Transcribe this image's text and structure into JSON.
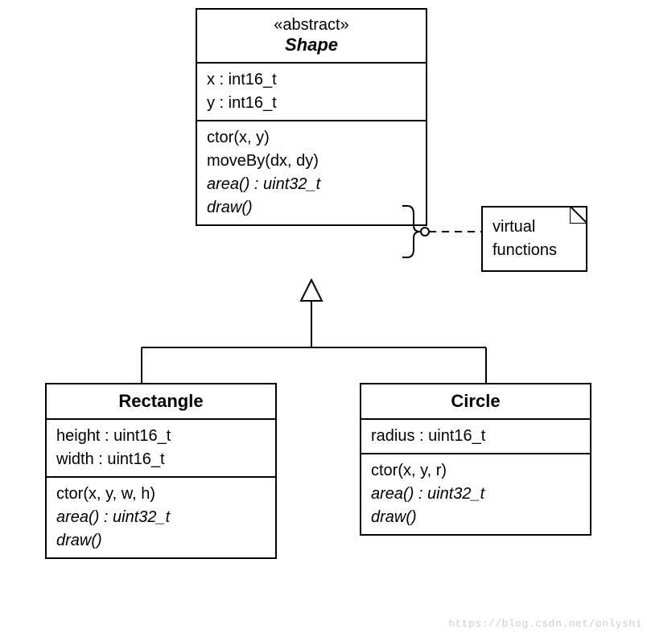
{
  "shape": {
    "stereotype": "«abstract»",
    "name": "Shape",
    "attrs": [
      "x : int16_t",
      "y : int16_t"
    ],
    "ops_plain": [
      "ctor(x, y)",
      "moveBy(dx, dy)"
    ],
    "ops_virtual": [
      "area() : uint32_t",
      "draw()"
    ]
  },
  "rectangle": {
    "name": "Rectangle",
    "attrs": [
      "height : uint16_t",
      "width  : uint16_t"
    ],
    "ops_plain": [
      "ctor(x, y, w, h)"
    ],
    "ops_virtual": [
      "area() : uint32_t",
      "draw()"
    ]
  },
  "circle": {
    "name": "Circle",
    "attrs": [
      "radius : uint16_t"
    ],
    "ops_plain": [
      "ctor(x, y, r)"
    ],
    "ops_virtual": [
      "area() : uint32_t",
      "draw()"
    ]
  },
  "note": {
    "line1": "virtual",
    "line2": "functions"
  },
  "watermark": "https://blog.csdn.net/onlyshi"
}
